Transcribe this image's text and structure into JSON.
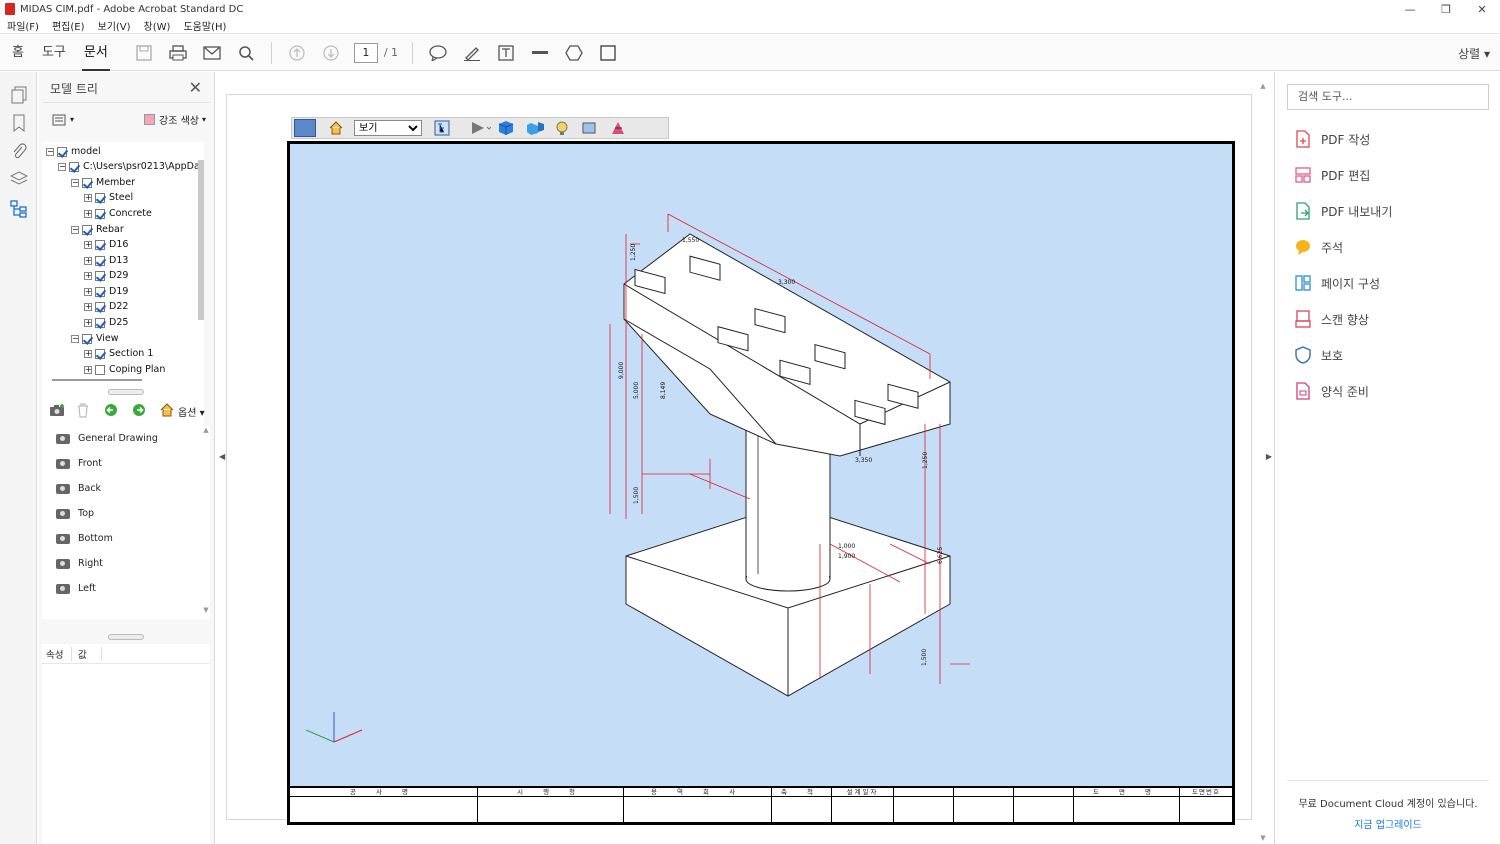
{
  "window": {
    "title": "MIDAS CIM.pdf - Adobe Acrobat Standard DC"
  },
  "menu": [
    "파일(F)",
    "편집(E)",
    "보기(V)",
    "창(W)",
    "도움말(H)"
  ],
  "toolbar": {
    "tabs": [
      "홈",
      "도구",
      "문서"
    ],
    "page_current": "1",
    "page_total": "/ 1",
    "share_label": "상렬"
  },
  "model_tree": {
    "title": "모델 트리",
    "highlight_label": "강조 색상",
    "highlight_color": "#f4a7b9",
    "items": [
      {
        "label": "model",
        "checked": true
      },
      {
        "label": "C:\\Users\\psr0213\\AppData\\",
        "checked": true
      },
      {
        "label": "Member",
        "checked": true
      },
      {
        "label": "Steel",
        "checked": true
      },
      {
        "label": "Concrete",
        "checked": true
      },
      {
        "label": "Rebar",
        "checked": true
      },
      {
        "label": "D16",
        "checked": true
      },
      {
        "label": "D13",
        "checked": true
      },
      {
        "label": "D29",
        "checked": true
      },
      {
        "label": "D19",
        "checked": true
      },
      {
        "label": "D22",
        "checked": true
      },
      {
        "label": "D25",
        "checked": true
      },
      {
        "label": "View",
        "checked": true
      },
      {
        "label": "Section 1",
        "checked": true
      },
      {
        "label": "Coping Plan",
        "checked": false
      }
    ],
    "views_options_label": "옵션",
    "views": [
      "General Drawing",
      "Front",
      "Back",
      "Top",
      "Bottom",
      "Right",
      "Left"
    ],
    "props_headers": [
      "속성",
      "값"
    ]
  },
  "toolbar3d": {
    "view_select": "보기"
  },
  "drawing": {
    "background": "#c5ddf7",
    "dimensions": [
      "1,250",
      "1,550",
      "3,300",
      "5,000",
      "8,149",
      "1,500",
      "9,000",
      "1,000",
      "1,900",
      "1,250",
      "3,350",
      "1,500",
      "6,625"
    ],
    "titleblock": [
      "공 사 명",
      "시 행 청",
      "용 역 회 사",
      "축 척",
      "설계일자",
      "",
      "",
      "",
      "도 면 명",
      "도면번호"
    ]
  },
  "right_panel": {
    "search_placeholder": "검색 도구...",
    "tools": [
      {
        "label": "PDF 작성",
        "color": "#e0484f"
      },
      {
        "label": "PDF 편집",
        "color": "#e45a87"
      },
      {
        "label": "PDF 내보내기",
        "color": "#2aa375"
      },
      {
        "label": "주석",
        "color": "#f3b41e"
      },
      {
        "label": "페이지 구성",
        "color": "#2a8fd6"
      },
      {
        "label": "스캔 향상",
        "color": "#d8475a"
      },
      {
        "label": "보호",
        "color": "#2f6fc0"
      },
      {
        "label": "양식 준비",
        "color": "#cf3f7a"
      }
    ],
    "cloud_text": "무료 Document Cloud 계정이 있습니다.",
    "upgrade_label": "지금 업그레이드"
  }
}
